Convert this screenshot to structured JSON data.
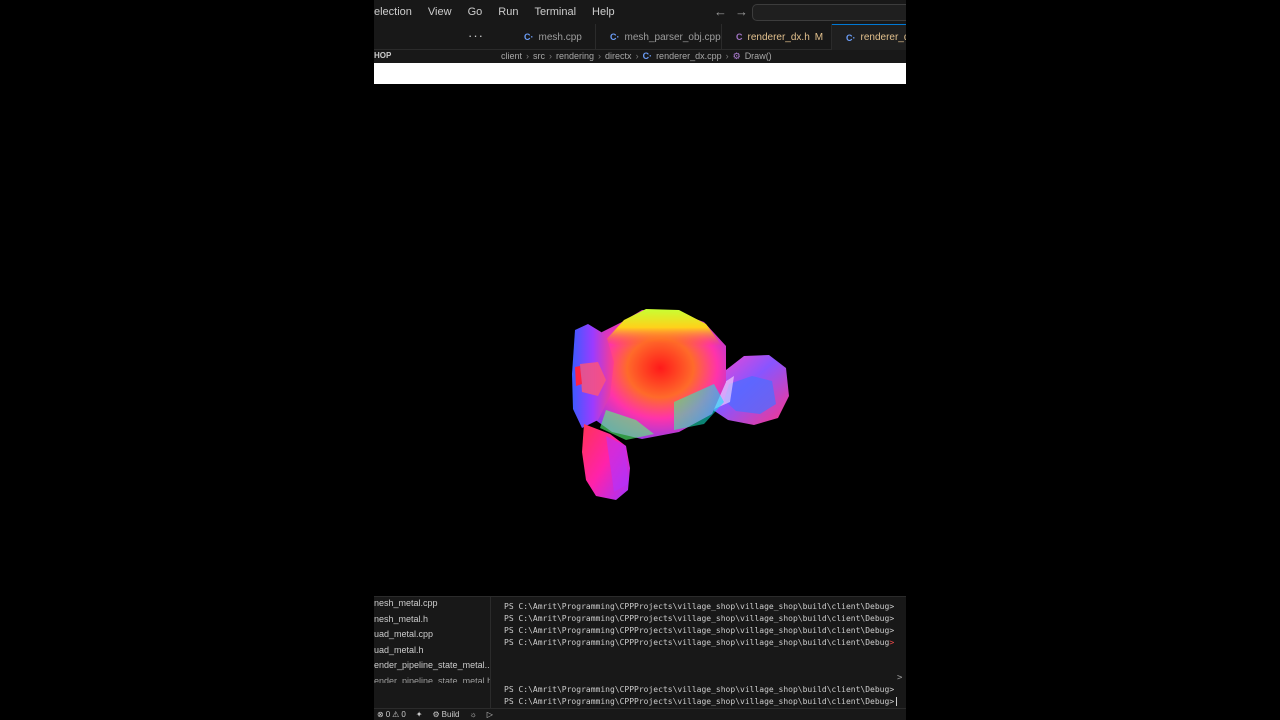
{
  "menubar": {
    "items": [
      "election",
      "View",
      "Go",
      "Run",
      "Terminal",
      "Help"
    ],
    "back_icon": "arrow-left-icon",
    "forward_icon": "arrow-right-icon"
  },
  "tabs": {
    "more_label": "···",
    "items": [
      {
        "label": "mesh.cpp",
        "icon_glyph": "C·",
        "icon": "cpp-file-icon"
      },
      {
        "label": "mesh_parser_obj.cpp",
        "icon_glyph": "C·",
        "icon": "cpp-file-icon"
      },
      {
        "label": "renderer_dx.h",
        "icon_glyph": "C",
        "icon": "header-file-icon",
        "flag": "M"
      },
      {
        "label": "renderer_dx.c",
        "icon_glyph": "C·",
        "icon": "cpp-file-icon"
      }
    ]
  },
  "sidebar": {
    "header": "HOP",
    "files": [
      "nesh_metal.cpp",
      "nesh_metal.h",
      "uad_metal.cpp",
      "uad_metal.h",
      "ender_pipeline_state_metal....",
      "ender_pipeline_state_metal.h"
    ]
  },
  "breadcrumb": {
    "parts": [
      "client",
      "src",
      "rendering",
      "directx"
    ],
    "file": "renderer_dx.cpp",
    "file_icon_glyph": "C·",
    "symbol": "Draw()",
    "symbol_icon": "method-cube-icon"
  },
  "terminal": {
    "lines": [
      "PS C:\\Amrit\\Programming\\CPPProjects\\village_shop\\village_shop\\build\\client\\Debug>",
      "PS C:\\Amrit\\Programming\\CPPProjects\\village_shop\\village_shop\\build\\client\\Debug>",
      "PS C:\\Amrit\\Programming\\CPPProjects\\village_shop\\village_shop\\build\\client\\Debug>",
      "PS C:\\Amrit\\Programming\\CPPProjects\\village_shop\\village_shop\\build\\client\\Debug"
    ],
    "bottom_lines": [
      "PS C:\\Amrit\\Programming\\CPPProjects\\village_shop\\village_shop\\build\\client\\Debug>",
      "PS C:\\Amrit\\Programming\\CPPProjects\\village_shop\\village_shop\\build\\client\\Debug>"
    ],
    "red_caret": ">",
    "marker": ">"
  },
  "statusbar": {
    "errors": "0",
    "warnings": "0",
    "build_label": "Build",
    "icons": [
      "error-icon",
      "warning-icon",
      "debug-icon",
      "gear-icon",
      "bug-icon",
      "play-icon"
    ]
  },
  "viewport": {
    "object": "suzanne-monkey-head",
    "colors": [
      "#ff1a1a",
      "#ff8c00",
      "#e0ff00",
      "#33ff66",
      "#00e5ff",
      "#3366ff",
      "#b233ff",
      "#ff33cc"
    ]
  }
}
